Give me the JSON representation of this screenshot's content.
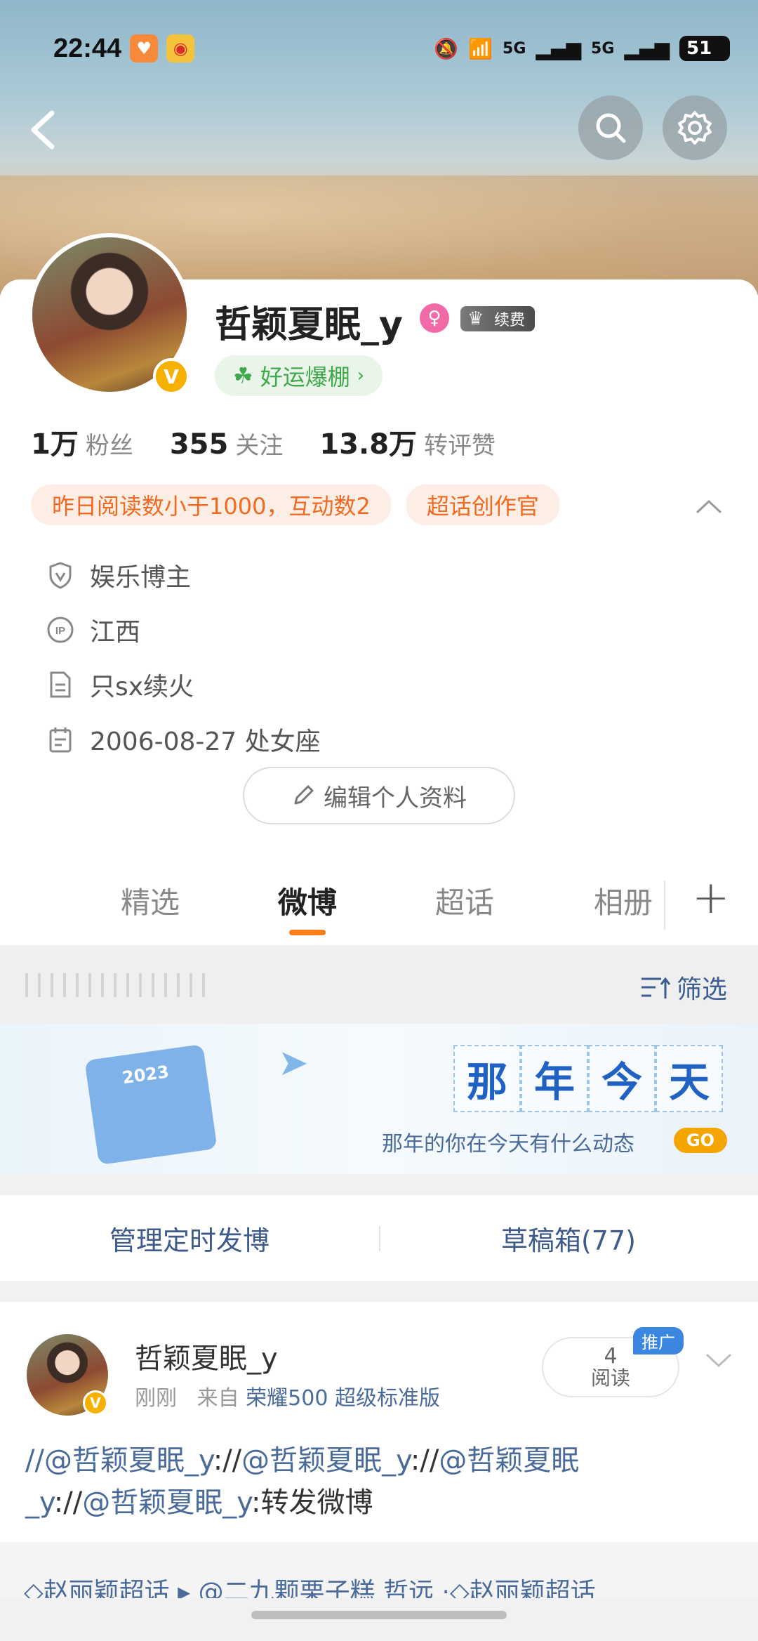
{
  "status": {
    "time": "22:44",
    "battery": "51",
    "signal1": "5G",
    "signal2": "5G"
  },
  "profile": {
    "name": "哲颖夏眠_y",
    "renew_label": "续费",
    "luck_label": "好运爆棚",
    "stats": [
      {
        "value": "1万",
        "label": "粉丝"
      },
      {
        "value": "355",
        "label": "关注"
      },
      {
        "value": "13.8万",
        "label": "转评赞"
      }
    ],
    "tags": [
      "昨日阅读数小于1000，互动数2",
      "超话创作官"
    ],
    "info": [
      {
        "icon": "shield-v-icon",
        "text": "娱乐博主"
      },
      {
        "icon": "ip-icon",
        "text": "江西"
      },
      {
        "icon": "document-icon",
        "text": "只sx续火"
      },
      {
        "icon": "calendar-icon",
        "text": "2006-08-27 处女座"
      }
    ],
    "edit_label": "编辑个人资料"
  },
  "tabs": {
    "items": [
      "精选",
      "微博",
      "超话",
      "相册"
    ],
    "active": "微博",
    "add": "+"
  },
  "filter_label": "筛选",
  "banner": {
    "chars": [
      "那",
      "年",
      "今",
      "天"
    ],
    "subtitle": "那年的你在今天有什么动态",
    "go": "GO"
  },
  "manage": {
    "scheduled": "管理定时发博",
    "drafts": "草稿箱(77)"
  },
  "post": {
    "author": "哲颖夏眠_y",
    "time": "刚刚",
    "source_prefix": "来自",
    "device": "荣耀500 超级标准版",
    "reads_count": "4",
    "reads_label": "阅读",
    "promo": "推广",
    "text_parts": [
      "//@哲颖夏眠_y",
      "://",
      "@哲颖夏眠_y",
      "://",
      "@哲颖夏眠",
      "_y",
      "://",
      "@哲颖夏眠_y",
      ":转发微博"
    ],
    "topics": "◇赵丽颖超话 ▸ @二九颗栗子糕  哲远 ·◇赵丽颖超话"
  }
}
